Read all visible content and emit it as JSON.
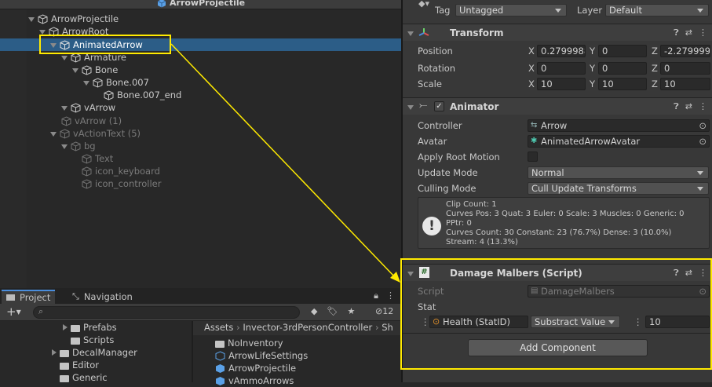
{
  "hierarchy": {
    "title": "ArrowProjectile",
    "items": [
      {
        "label": "ArrowProjectile"
      },
      {
        "label": "ArrowRoot"
      },
      {
        "label": "AnimatedArrow"
      },
      {
        "label": "Armature"
      },
      {
        "label": "Bone"
      },
      {
        "label": "Bone.007"
      },
      {
        "label": "Bone.007_end"
      },
      {
        "label": "vArrow"
      },
      {
        "label": "vArrow (1)"
      },
      {
        "label": "vActionText (5)"
      },
      {
        "label": "bg"
      },
      {
        "label": "Text"
      },
      {
        "label": "icon_keyboard"
      },
      {
        "label": "icon_controller"
      }
    ]
  },
  "inspector": {
    "tag_label": "Tag",
    "tag_value": "Untagged",
    "layer_label": "Layer",
    "layer_value": "Default",
    "transform": {
      "title": "Transform",
      "position_label": "Position",
      "rotation_label": "Rotation",
      "scale_label": "Scale",
      "x": "X",
      "y": "Y",
      "z": "Z",
      "position": [
        "0.2799988",
        "0",
        "-2.279999"
      ],
      "rotation": [
        "0",
        "0",
        "0"
      ],
      "scale": [
        "10",
        "10",
        "10"
      ]
    },
    "animator": {
      "title": "Animator",
      "controller_label": "Controller",
      "controller_value": "Arrow",
      "avatar_label": "Avatar",
      "avatar_value": "AnimatedArrowAvatar",
      "root_motion_label": "Apply Root Motion",
      "update_mode_label": "Update Mode",
      "update_mode_value": "Normal",
      "culling_label": "Culling Mode",
      "culling_value": "Cull Update Transforms",
      "info": [
        "Clip Count: 1",
        "Curves Pos: 3 Quat: 3 Euler: 0 Scale: 3 Muscles: 0 Generic: 0",
        "PPtr: 0",
        "Curves Count: 30 Constant: 23 (76.7%) Dense: 3 (10.0%)",
        "Stream: 4 (13.3%)"
      ]
    },
    "damage": {
      "title": "Damage Malbers (Script)",
      "script_label": "Script",
      "script_value": "DamageMalbers",
      "stat_label": "Stat",
      "stat_id": "Health (StatID)",
      "stat_mode": "Substract Value",
      "stat_amount": "10"
    },
    "add_component": "Add Component"
  },
  "project": {
    "tab_project": "Project",
    "tab_navigation": "Navigation",
    "count": "12",
    "folders": [
      "Prefabs",
      "Scripts",
      "DecalManager",
      "Editor",
      "Generic"
    ],
    "breadcrumb": [
      "Assets",
      "Invector-3rdPersonController",
      "Sh"
    ],
    "assets": [
      "NoInventory",
      "ArrowLifeSettings",
      "ArrowProjectile",
      "vAmmoArrows"
    ]
  },
  "colors": {
    "highlight": "#ffea00",
    "selection": "#2c5d87",
    "accent": "#4a8ddc"
  }
}
